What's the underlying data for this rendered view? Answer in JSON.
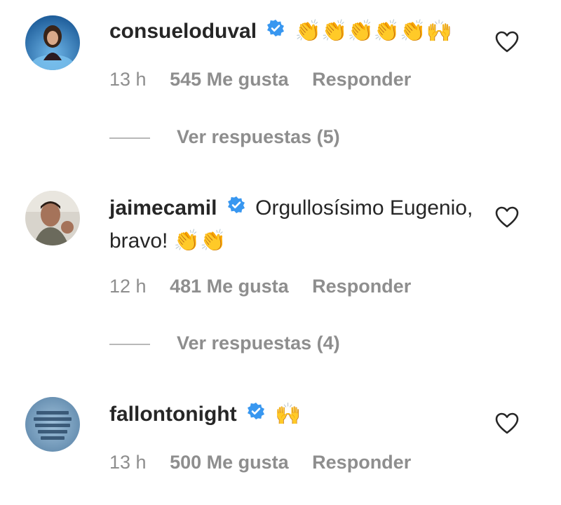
{
  "comments": [
    {
      "username": "consueloduval",
      "verified": true,
      "text": "",
      "emoji": "👏👏👏👏👏🙌",
      "time": "13 h",
      "likes": "545 Me gusta",
      "reply_label": "Responder",
      "view_replies": "Ver respuestas (5)"
    },
    {
      "username": "jaimecamil",
      "verified": true,
      "text": "Orgullosísimo Eugenio, bravo!",
      "emoji": "👏👏",
      "time": "12 h",
      "likes": "481 Me gusta",
      "reply_label": "Responder",
      "view_replies": "Ver respuestas (4)"
    },
    {
      "username": "fallontonight",
      "verified": true,
      "text": "",
      "emoji": "🙌",
      "time": "13 h",
      "likes": "500 Me gusta",
      "reply_label": "Responder"
    }
  ],
  "colors": {
    "verified_badge": "#3897f0",
    "meta_text": "#8e8e8e",
    "primary_text": "#262626"
  },
  "icons": {
    "like": "heart-outline-icon",
    "verified": "verified-badge-icon"
  }
}
